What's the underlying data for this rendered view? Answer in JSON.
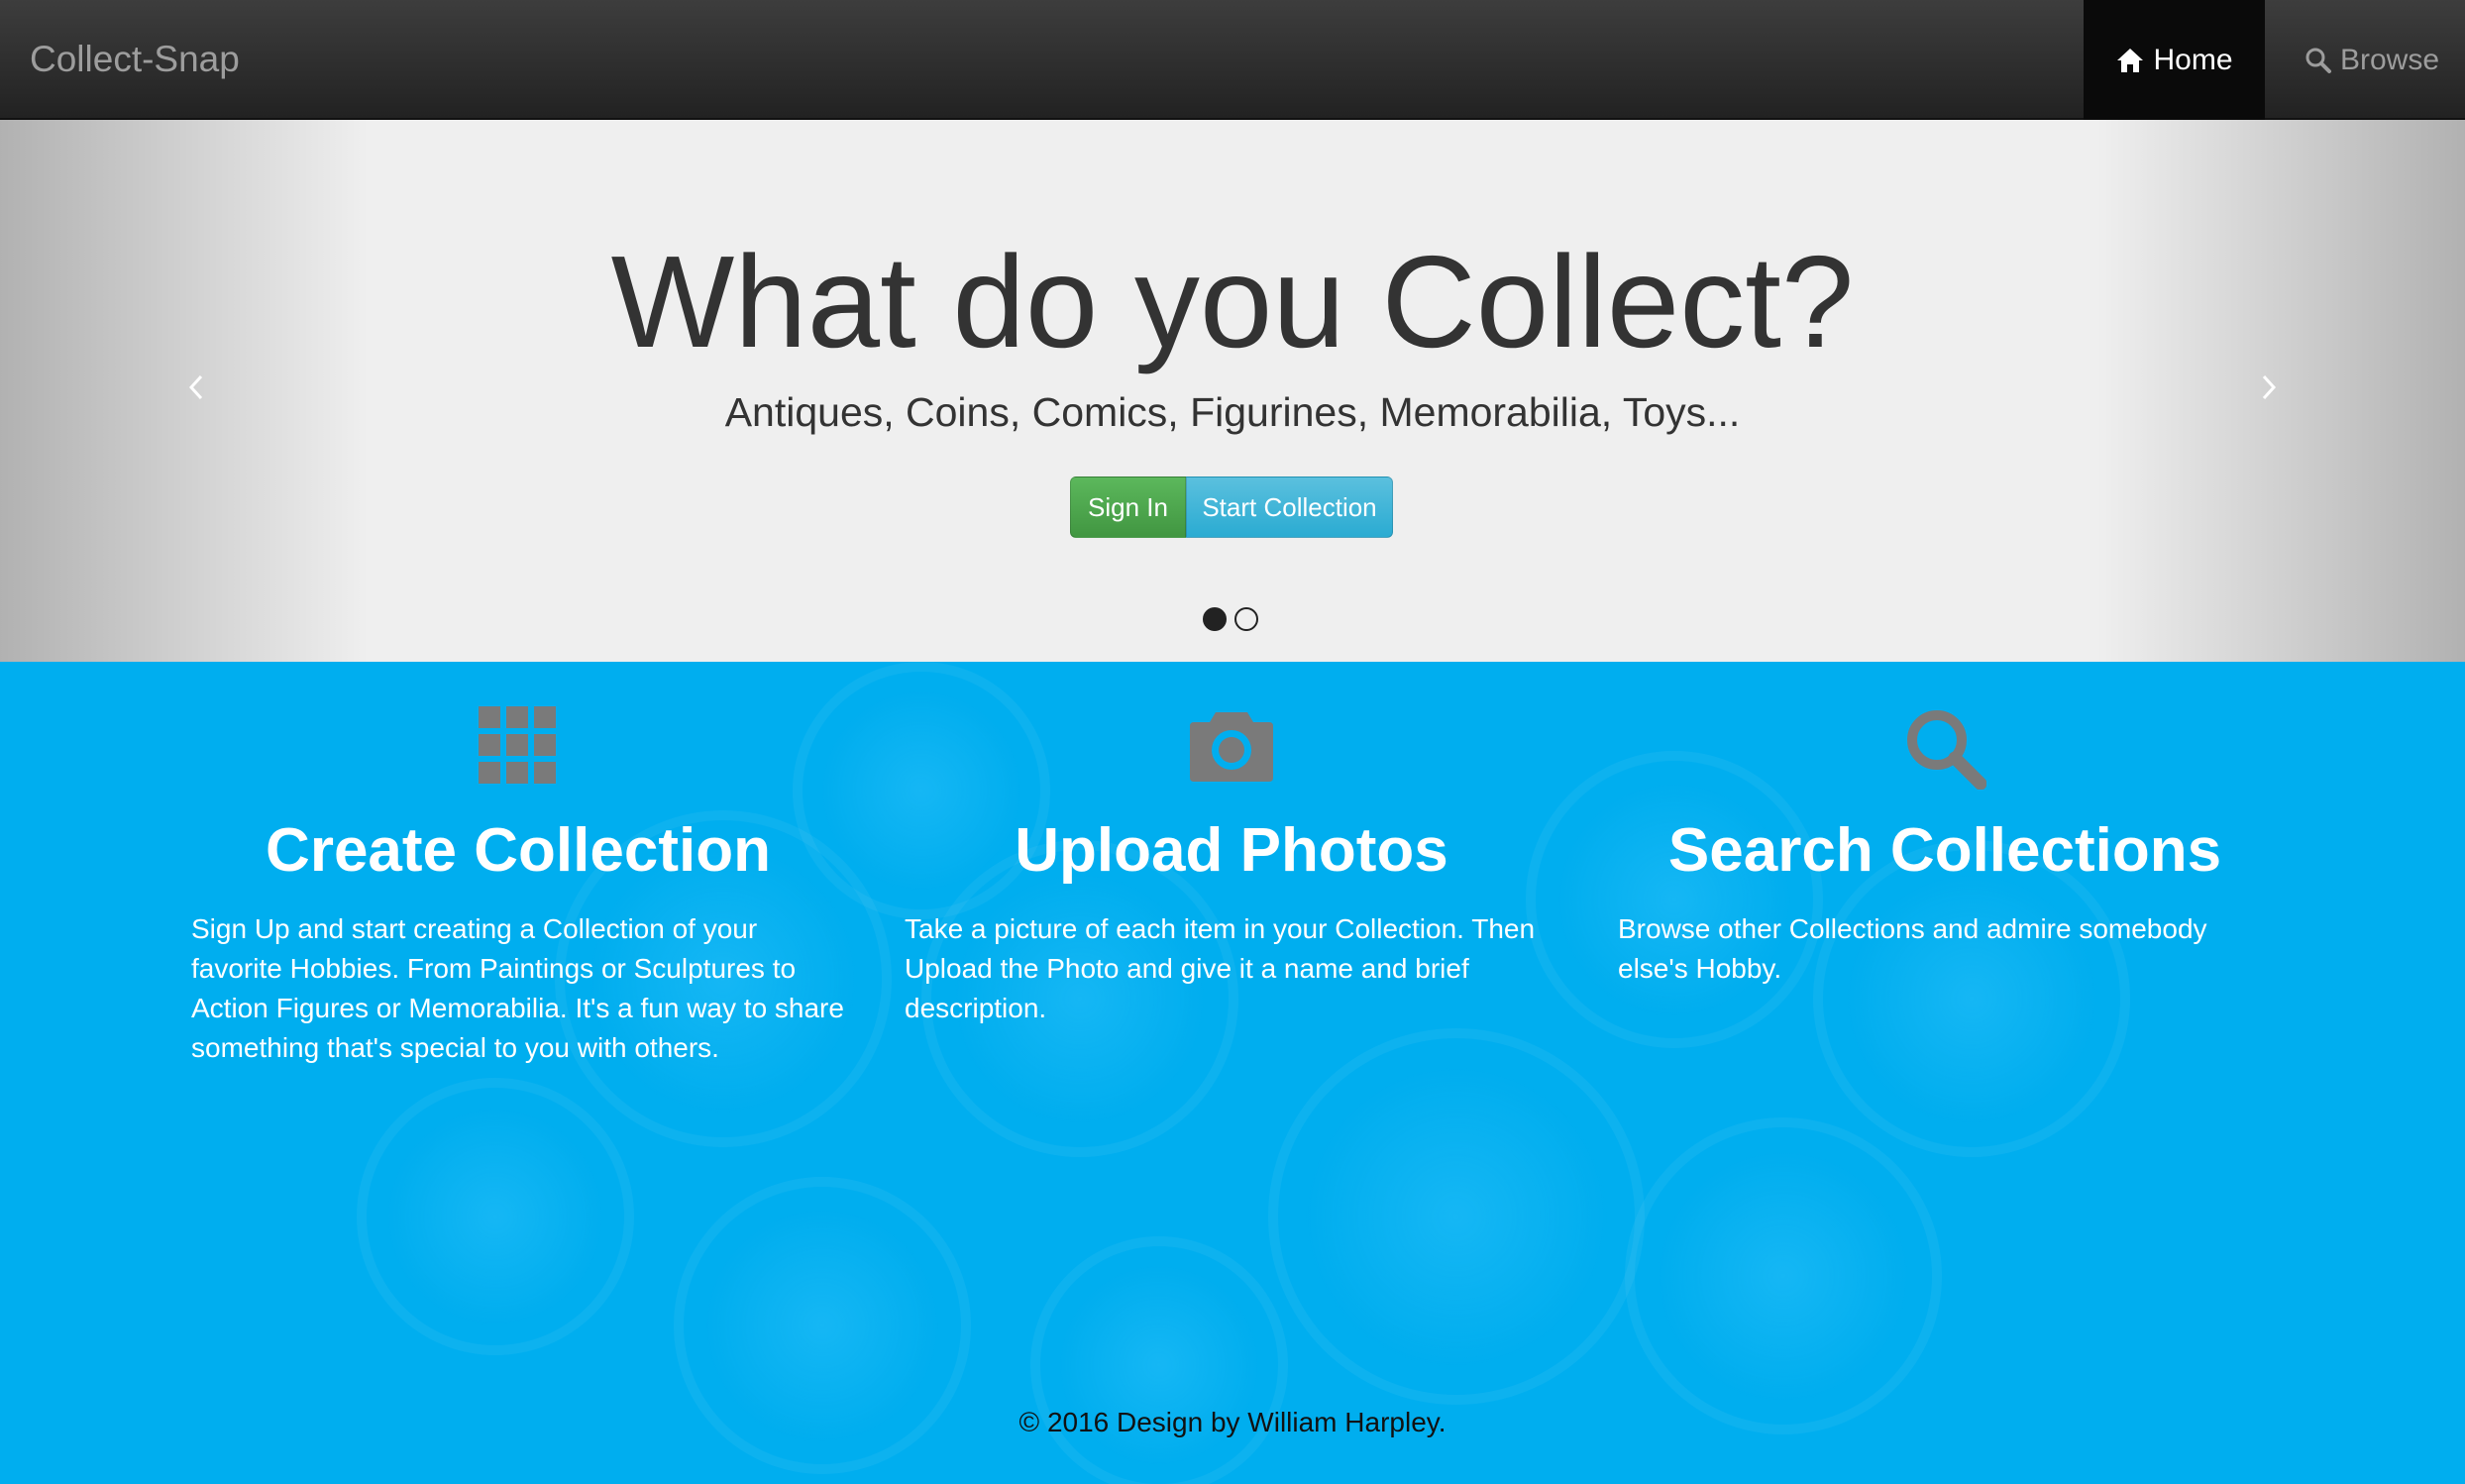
{
  "navbar": {
    "brand": "Collect-Snap",
    "items": [
      {
        "label": "Home",
        "icon": "home-icon",
        "active": true
      },
      {
        "label": "Browse",
        "icon": "search-icon",
        "active": false
      }
    ]
  },
  "hero": {
    "headline": "What do you Collect?",
    "subhead": "Antiques, Coins, Comics, Figurines, Memorabilia, Toys...",
    "buttons": {
      "sign_in": "Sign In",
      "start_collection": "Start Collection"
    },
    "slide_count": 2,
    "active_slide": 1
  },
  "features": [
    {
      "icon": "grid-icon",
      "title": "Create Collection",
      "text": "Sign Up and start creating a Collection of your favorite Hobbies. From Paintings or Sculptures to Action Figures or Memorabilia. It's a fun way to share something that's special to you with others."
    },
    {
      "icon": "camera-icon",
      "title": "Upload Photos",
      "text": "Take a picture of each item in your Collection. Then Upload the Photo and give it a name and brief description."
    },
    {
      "icon": "search-icon",
      "title": "Search Collections",
      "text": "Browse other Collections and admire somebody else's Hobby."
    }
  ],
  "footer": {
    "text": "© 2016 Design by William Harpley."
  },
  "colors": {
    "navbar_bg": "#222222",
    "features_bg": "#00aeef",
    "icon_gray": "#7a7a7a",
    "btn_success": "#5cb85c",
    "btn_info": "#5bc0de"
  }
}
